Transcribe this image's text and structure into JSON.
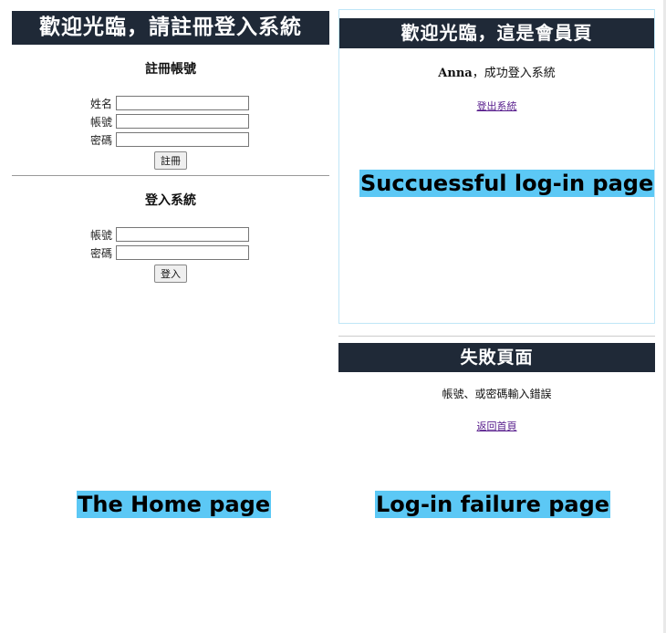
{
  "home": {
    "banner": "歡迎光臨，請註冊登入系統",
    "register": {
      "title": "註冊帳號",
      "name_label": "姓名",
      "account_label": "帳號",
      "password_label": "密碼",
      "submit_label": "註冊"
    },
    "login": {
      "title": "登入系統",
      "account_label": "帳號",
      "password_label": "密碼",
      "submit_label": "登入"
    }
  },
  "success": {
    "banner": "歡迎光臨，這是會員頁",
    "user_name": "Anna",
    "message": "，成功登入系統",
    "logout_link": "登出系統"
  },
  "failure": {
    "banner": "失敗頁面",
    "message": "帳號、或密碼輸入錯誤",
    "back_link": "返回首頁"
  },
  "captions": {
    "success": "Succuessful log-in page",
    "home": "The Home page",
    "failure": "Log-in failure page"
  },
  "colors": {
    "banner_bg": "#1f2937",
    "caption_highlight": "#5cc8f5",
    "link": "#551a8b"
  }
}
